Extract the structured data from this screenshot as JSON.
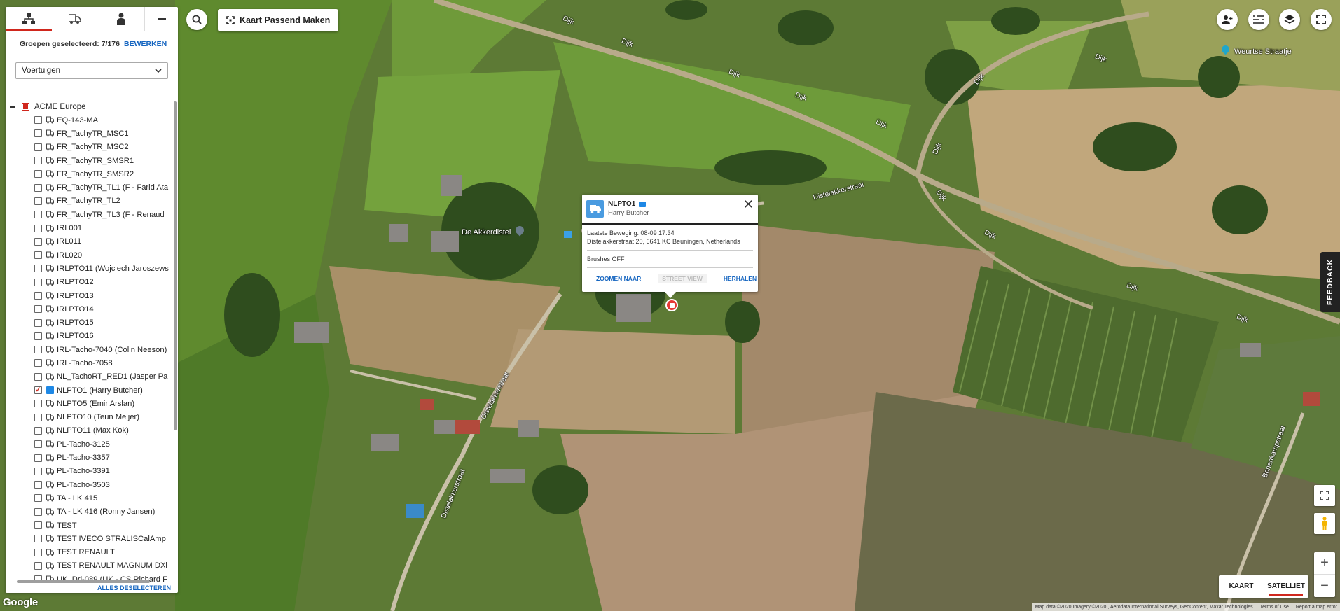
{
  "panel": {
    "tabs": [
      {
        "icon": "hierarchy-icon",
        "active": true
      },
      {
        "icon": "truck-icon",
        "active": false
      },
      {
        "icon": "person-icon",
        "active": false
      }
    ],
    "groups_label": "Groepen geselecteerd: 7/176",
    "edit_label": "BEWERKEN",
    "select_value": "Voertuigen",
    "root_label": "ACME Europe",
    "items": [
      {
        "label": "EQ-143-MA",
        "checked": false
      },
      {
        "label": "FR_TachyTR_MSC1",
        "checked": false
      },
      {
        "label": "FR_TachyTR_MSC2",
        "checked": false
      },
      {
        "label": "FR_TachyTR_SMSR1",
        "checked": false
      },
      {
        "label": "FR_TachyTR_SMSR2",
        "checked": false
      },
      {
        "label": "FR_TachyTR_TL1 (F - Farid Ata",
        "checked": false
      },
      {
        "label": "FR_TachyTR_TL2",
        "checked": false
      },
      {
        "label": "FR_TachyTR_TL3 (F - Renaud",
        "checked": false
      },
      {
        "label": "IRL001",
        "checked": false
      },
      {
        "label": "IRL011",
        "checked": false
      },
      {
        "label": "IRL020",
        "checked": false
      },
      {
        "label": "IRLPTO11 (Wojciech Jaroszews",
        "checked": false
      },
      {
        "label": "IRLPTO12",
        "checked": false
      },
      {
        "label": "IRLPTO13",
        "checked": false
      },
      {
        "label": "IRLPTO14",
        "checked": false
      },
      {
        "label": "IRLPTO15",
        "checked": false
      },
      {
        "label": "IRLPTO16",
        "checked": false
      },
      {
        "label": "IRL-Tacho-7040 (Colin Neeson)",
        "checked": false
      },
      {
        "label": "IRL-Tacho-7058",
        "checked": false
      },
      {
        "label": "NL_TachoRT_RED1 (Jasper Pa",
        "checked": false
      },
      {
        "label": "NLPTO1 (Harry Butcher)",
        "checked": true
      },
      {
        "label": "NLPTO5 (Emir Arslan)",
        "checked": false
      },
      {
        "label": "NLPTO10 (Teun Meijer)",
        "checked": false
      },
      {
        "label": "NLPTO11 (Max Kok)",
        "checked": false
      },
      {
        "label": "PL-Tacho-3125",
        "checked": false
      },
      {
        "label": "PL-Tacho-3357",
        "checked": false
      },
      {
        "label": "PL-Tacho-3391",
        "checked": false
      },
      {
        "label": "PL-Tacho-3503",
        "checked": false
      },
      {
        "label": "TA - LK 415",
        "checked": false
      },
      {
        "label": "TA - LK 416 (Ronny Jansen)",
        "checked": false
      },
      {
        "label": "TEST",
        "checked": false
      },
      {
        "label": "TEST IVECO STRALISCalAmp",
        "checked": false
      },
      {
        "label": "TEST RENAULT",
        "checked": false
      },
      {
        "label": "TEST RENAULT MAGNUM DXi",
        "checked": false
      },
      {
        "label": "UK_Drj-089 (UK - CS Richard F",
        "checked": false
      }
    ],
    "deselect_label": "ALLES DESELECTEREN"
  },
  "toolbar": {
    "fit_label": "Kaart Passend Maken"
  },
  "popup": {
    "vehicle": "NLPTO1",
    "driver": "Harry Butcher",
    "last_move": "Laatste Beweging: 08-09 17:34",
    "address": "Distelakkerstraat 20, 6641 KC Beuningen, Netherlands",
    "status": "Brushes OFF",
    "actions": {
      "zoom": "ZOOMEN NAAR",
      "streetview": "STREET VIEW",
      "repeat": "HERHALEN"
    }
  },
  "map": {
    "labels": [
      {
        "text": "Dijk"
      },
      {
        "text": "Dijk"
      },
      {
        "text": "Dijk"
      },
      {
        "text": "Dijk"
      },
      {
        "text": "Dijk"
      },
      {
        "text": "Dijk"
      },
      {
        "text": "Dijk"
      },
      {
        "text": "Dijk"
      },
      {
        "text": "Dijk"
      },
      {
        "text": "Dijk"
      },
      {
        "text": "Distelakkerstraat"
      },
      {
        "text": "Distelakkerstraat"
      },
      {
        "text": "Distelakkerstraat"
      },
      {
        "text": "Bonenkampstraat"
      }
    ],
    "poi_akkerdistel": "De Akkerdistel",
    "poi_weurtse": "Weurtse Straatje",
    "feedback": "FEEDBACK",
    "maptype": {
      "map": "KAART",
      "satellite": "SATELLIET"
    },
    "zoom_in": "+",
    "zoom_out": "−",
    "google": "Google",
    "attribution": [
      "Map data ©2020 Imagery ©2020 , Aerodata International Surveys, GeoContent, Maxar Technologies",
      "Terms of Use",
      "Report a map error"
    ]
  },
  "colors": {
    "accent": "#d0271d",
    "link": "#1565c0",
    "badge": "#1e88e5",
    "marker": "#e53935"
  }
}
